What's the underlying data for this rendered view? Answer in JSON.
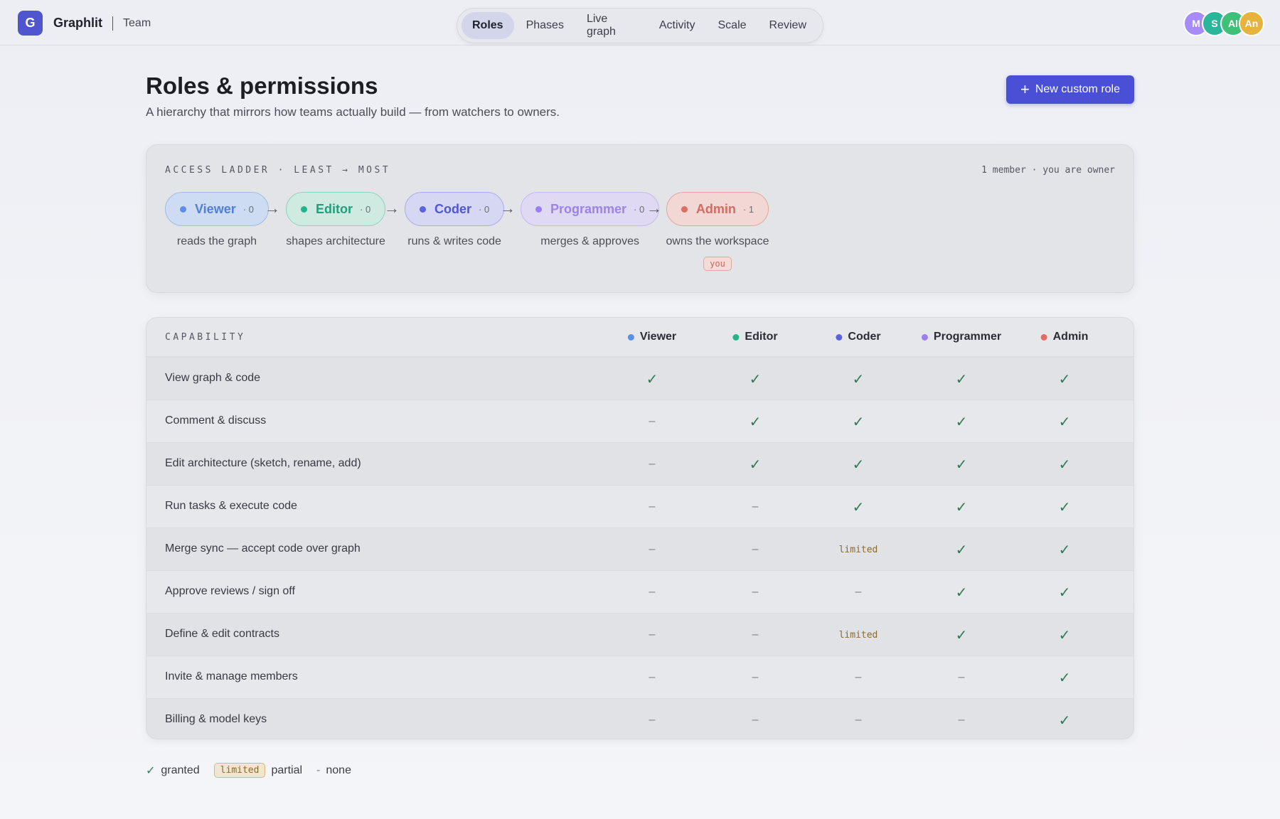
{
  "app": {
    "logo_letter": "G",
    "name": "Graphlit",
    "section": "Team"
  },
  "nav": {
    "tabs": [
      {
        "label": "Roles",
        "active": true
      },
      {
        "label": "Phases",
        "active": false
      },
      {
        "label": "Live graph",
        "active": false
      },
      {
        "label": "Activity",
        "active": false
      },
      {
        "label": "Scale",
        "active": false
      },
      {
        "label": "Review",
        "active": false
      }
    ]
  },
  "members": [
    {
      "initials": "M",
      "color": "#a78bfa"
    },
    {
      "initials": "S",
      "color": "#2bb59a"
    },
    {
      "initials": "Al",
      "color": "#3fbf78"
    },
    {
      "initials": "An",
      "color": "#e6b33c"
    }
  ],
  "header": {
    "title": "Roles & permissions",
    "subtitle": "A hierarchy that mirrors how teams actually build — from watchers to owners.",
    "new_role_button": "New custom role"
  },
  "ladder": {
    "title": "ACCESS LADDER · LEAST → MOST",
    "meta": "1 member · you are owner",
    "arrow": "→",
    "you_label": "you",
    "roles": [
      {
        "name": "Viewer",
        "count": "· 0",
        "desc": "reads the graph",
        "color": "#5b8ee6",
        "bg": "#cddcf3",
        "border": "#9fbbe8",
        "text": "#4f7fd8"
      },
      {
        "name": "Editor",
        "count": "· 0",
        "desc": "shapes architecture",
        "color": "#23b389",
        "bg": "#cfeae0",
        "border": "#8fd3bb",
        "text": "#1f9f7a"
      },
      {
        "name": "Coder",
        "count": "· 0",
        "desc": "runs & writes code",
        "color": "#5a62e0",
        "bg": "#d6d8f3",
        "border": "#a9aceb",
        "text": "#4f56d6"
      },
      {
        "name": "Programmer",
        "count": "· 0",
        "desc": "merges & approves",
        "color": "#9b7ff0",
        "bg": "#e0d9f3",
        "border": "#c7b7f0",
        "text": "#9b83ea"
      },
      {
        "name": "Admin",
        "count": "· 1",
        "desc": "owns the workspace",
        "color": "#e06d62",
        "bg": "#f1d8d4",
        "border": "#e3a59c",
        "text": "#d86a5e",
        "is_you": true
      }
    ]
  },
  "table": {
    "capability_header": "CAPABILITY",
    "columns": [
      {
        "name": "Viewer",
        "color": "#5b8ee6"
      },
      {
        "name": "Editor",
        "color": "#23b389"
      },
      {
        "name": "Coder",
        "color": "#5a62e0"
      },
      {
        "name": "Programmer",
        "color": "#9b7ff0"
      },
      {
        "name": "Admin",
        "color": "#e06d62"
      }
    ],
    "rows": [
      {
        "label": "View graph & code",
        "cells": [
          "check",
          "check",
          "check",
          "check",
          "check"
        ]
      },
      {
        "label": "Comment & discuss",
        "cells": [
          "none",
          "check",
          "check",
          "check",
          "check"
        ]
      },
      {
        "label": "Edit architecture (sketch, rename, add)",
        "cells": [
          "none",
          "check",
          "check",
          "check",
          "check"
        ]
      },
      {
        "label": "Run tasks & execute code",
        "cells": [
          "none",
          "none",
          "check",
          "check",
          "check"
        ]
      },
      {
        "label": "Merge sync — accept code over graph",
        "cells": [
          "none",
          "none",
          "limited",
          "check",
          "check"
        ]
      },
      {
        "label": "Approve reviews / sign off",
        "cells": [
          "none",
          "none",
          "none",
          "check",
          "check"
        ]
      },
      {
        "label": "Define & edit contracts",
        "cells": [
          "none",
          "none",
          "limited",
          "check",
          "check"
        ]
      },
      {
        "label": "Invite & manage members",
        "cells": [
          "none",
          "none",
          "none",
          "none",
          "check"
        ]
      },
      {
        "label": "Billing & model keys",
        "cells": [
          "none",
          "none",
          "none",
          "none",
          "check"
        ]
      }
    ],
    "glyphs": {
      "check": "✓",
      "none": "–",
      "limited": "limited"
    }
  },
  "legend": {
    "granted_symbol": "✓",
    "granted_label": "granted",
    "limited_tag": "limited",
    "partial_label": "partial",
    "none_symbol": "-",
    "none_label": "none"
  }
}
